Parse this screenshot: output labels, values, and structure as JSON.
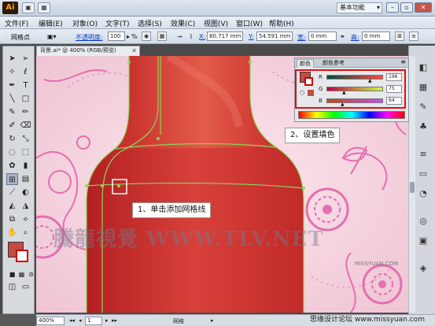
{
  "app": {
    "logo": "Ai",
    "workspace": "基本功能"
  },
  "menu": [
    "文件(F)",
    "编辑(E)",
    "对象(O)",
    "文字(T)",
    "选择(S)",
    "效果(C)",
    "视图(V)",
    "窗口(W)",
    "帮助(H)"
  ],
  "control": {
    "tool_name": "网格点",
    "opacity_label": "不透明度:",
    "opacity_value": "100",
    "opacity_unit": "%",
    "x_label": "X:",
    "x_value": "80.717 mm",
    "y_label": "Y:",
    "y_value": "54.591 mm",
    "w_label": "宽:",
    "w_value": "0 mm",
    "h_label": "高:",
    "h_value": "0 mm"
  },
  "document": {
    "tab_title": "背景.ai* @ 400% (RGB/预览)"
  },
  "color_panel": {
    "tabs": [
      "颜色",
      "颜色参考"
    ],
    "r_label": "R",
    "r_value": "196",
    "g_label": "G",
    "g_value": "75",
    "b_label": "B",
    "b_value": "64",
    "fill_color": "#c44b40"
  },
  "callouts": {
    "step1": "1、单击添加网格线",
    "step2": "2、设置填色"
  },
  "watermark": "騰龍視覺 WWW.TLV.NET",
  "watermark_small": "MISSYUAN.COM",
  "status": {
    "zoom": "400%",
    "page": "1",
    "mode": "网格",
    "site": "思缘设计论坛  www.missyuan.com"
  },
  "colors": {
    "bottle": "#c9302c",
    "bottle_light": "#e65a46",
    "background": "#f4d5e0",
    "accent_pink": "#e36fb0",
    "highlight": "#e01010"
  }
}
